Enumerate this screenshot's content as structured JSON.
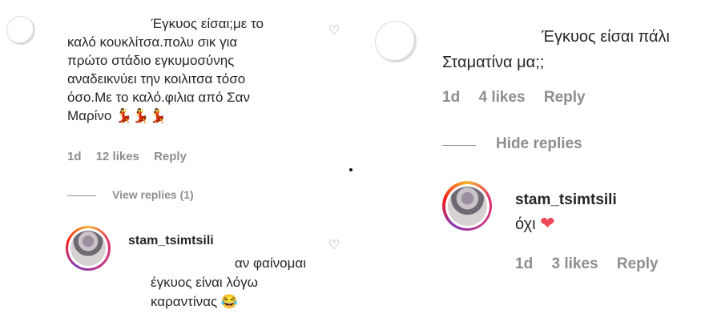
{
  "left": {
    "comment": {
      "username": "",
      "text_lines": [
        "Έγκυος είσαι;με το",
        "καλό κουκλίτσα.πολυ σικ για",
        "πρώτο στάδιο εγκυμοσύνης",
        "αναδεικνύει την κοιλιτσα τόσο",
        "όσο.Με το καλό.φιλια από Σαν",
        "Μαρίνο"
      ],
      "emoji": "💃💃💃",
      "time": "1d",
      "likes": "12 likes",
      "reply": "Reply"
    },
    "view_replies": "View replies (1)",
    "reply": {
      "username": "stam_tsimtsili",
      "text_lines": [
        "αν φαίνομαι",
        "έγκυος είναι λόγω",
        "καραντίνας"
      ],
      "emoji": "😂"
    }
  },
  "right": {
    "comment": {
      "text_lines": [
        "Έγκυος είσαι πάλι",
        "Σταματίνα μα;;"
      ],
      "time": "1d",
      "likes": "4 likes",
      "reply": "Reply"
    },
    "hide_replies": "Hide replies",
    "reply": {
      "username": "stam_tsimtsili",
      "text": "όχι",
      "emoji": "❤️",
      "time": "1d",
      "likes": "3 likes",
      "reply": "Reply"
    }
  },
  "icons": {
    "like_heart": "heart-outline-icon",
    "red_heart": "red-heart-icon"
  },
  "colors": {
    "text": "#262626",
    "meta": "#8e8e8e",
    "heart": "#ed4956"
  }
}
